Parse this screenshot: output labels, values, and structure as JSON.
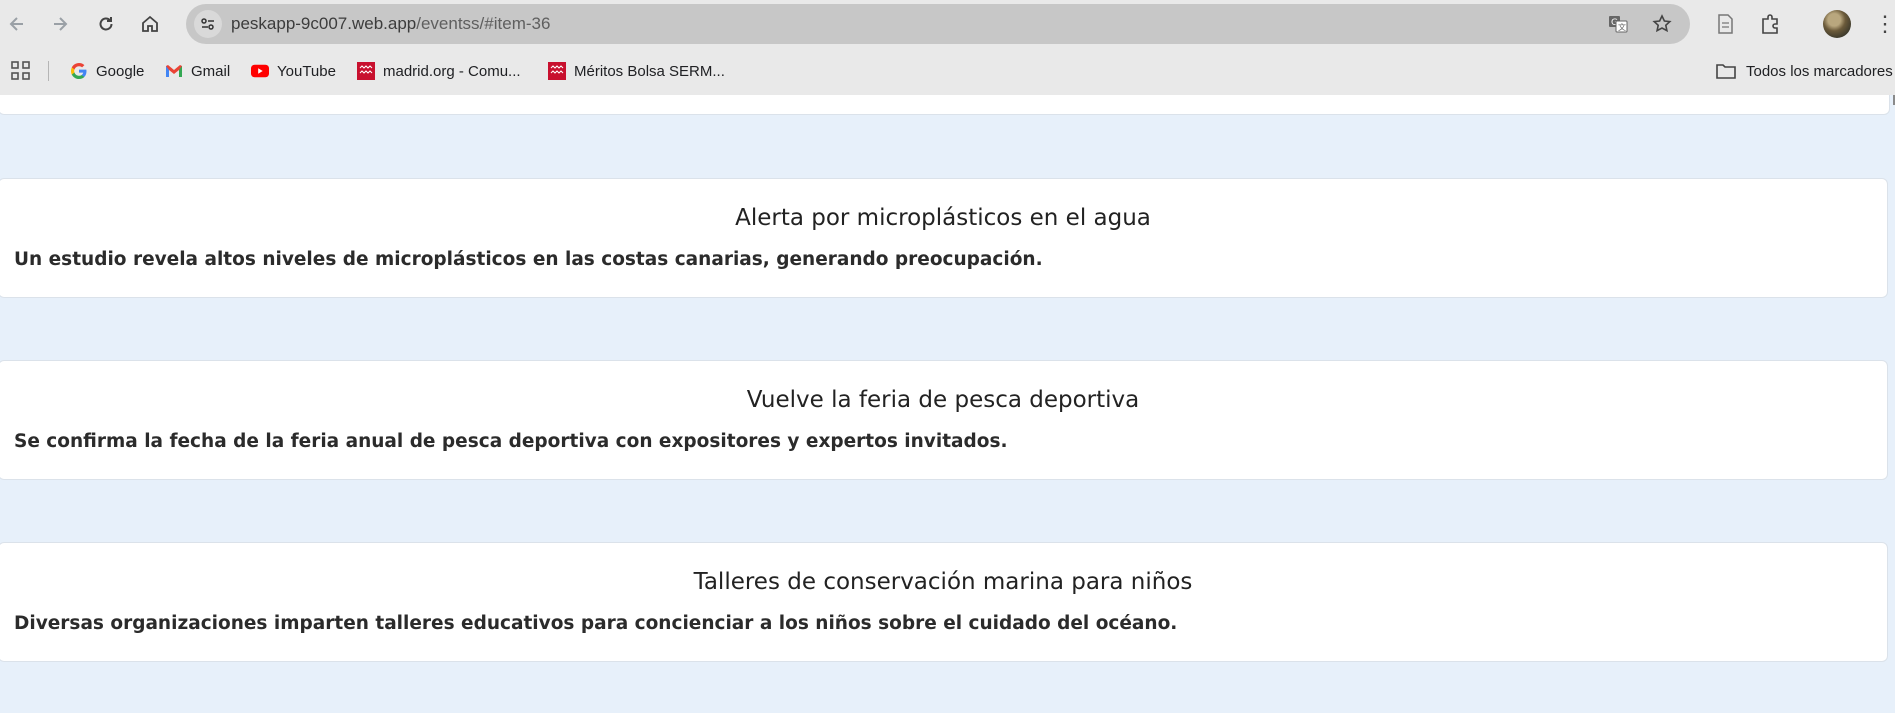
{
  "browser": {
    "url_host": "peskapp-9c007.web.app",
    "url_path": "/eventss/#item-36",
    "bookmarks": [
      {
        "label": "Google",
        "icon": "google-icon"
      },
      {
        "label": "Gmail",
        "icon": "gmail-icon"
      },
      {
        "label": "YouTube",
        "icon": "youtube-icon"
      },
      {
        "label": "madrid.org - Comu...",
        "icon": "madrid-icon"
      },
      {
        "label": "Méritos Bolsa SERM...",
        "icon": "madrid-icon"
      }
    ],
    "all_bookmarks_label": "Todos los marcadores"
  },
  "events": [
    {
      "title": "Alerta por microplásticos en el agua",
      "description": "Un estudio revela altos niveles de microplásticos en las costas canarias, generando preocupación."
    },
    {
      "title": "Vuelve la feria de pesca deportiva",
      "description": "Se confirma la fecha de la feria anual de pesca deportiva con expositores y expertos invitados."
    },
    {
      "title": "Talleres de conservación marina para niños",
      "description": "Diversas organizaciones imparten talleres educativos para concienciar a los niños sobre el cuidado del océano."
    }
  ],
  "colors": {
    "page_background": "#e7f0fa",
    "card_background": "#ffffff",
    "youtube_red": "#ff0000",
    "madrid_red": "#c8102e"
  }
}
